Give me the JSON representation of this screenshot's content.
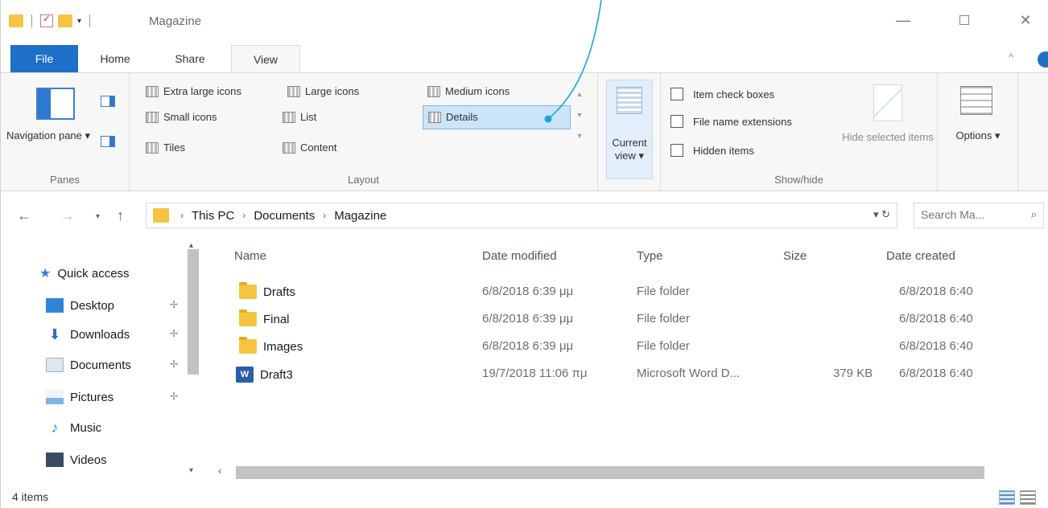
{
  "window": {
    "title": "Magazine",
    "controls": {
      "minimize": "—",
      "close": "✕"
    }
  },
  "tabs": [
    {
      "label": "File"
    },
    {
      "label": "Home"
    },
    {
      "label": "Share"
    },
    {
      "label": "View"
    }
  ],
  "ribbon": {
    "panes": {
      "navigation_pane": "Navigation pane ▾",
      "group_label": "Panes"
    },
    "layout": {
      "items": [
        "Extra large icons",
        "Large icons",
        "Medium icons",
        "Small icons",
        "List",
        "Details",
        "Tiles",
        "Content"
      ],
      "selected": "Details",
      "group_label": "Layout"
    },
    "current_view": {
      "label": "Current view ▾"
    },
    "show_hide": {
      "checkboxes": [
        "Item check boxes",
        "File name extensions",
        "Hidden items"
      ],
      "hide_selected": "Hide selected items",
      "group_label": "Show/hide"
    },
    "options": {
      "label": "Options ▾"
    }
  },
  "address": {
    "crumbs": [
      "This PC",
      "Documents",
      "Magazine"
    ],
    "search_placeholder": "Search Ma..."
  },
  "sidebar": {
    "items": [
      {
        "label": "Quick access",
        "icon": "star-icon",
        "pinned": false
      },
      {
        "label": "Desktop",
        "icon": "desktop-icon",
        "pinned": true
      },
      {
        "label": "Downloads",
        "icon": "download-arrow-icon",
        "pinned": true
      },
      {
        "label": "Documents",
        "icon": "documents-icon",
        "pinned": true
      },
      {
        "label": "Pictures",
        "icon": "pictures-icon",
        "pinned": true
      },
      {
        "label": "Music",
        "icon": "music-icon",
        "pinned": false
      },
      {
        "label": "Videos",
        "icon": "videos-icon",
        "pinned": false
      }
    ]
  },
  "files": {
    "columns": [
      "Name",
      "Date modified",
      "Type",
      "Size",
      "Date created"
    ],
    "rows": [
      {
        "name": "Drafts",
        "modified": "6/8/2018 6:39 μμ",
        "type": "File folder",
        "size": "",
        "created": "6/8/2018 6:40",
        "icon": "folder-icon"
      },
      {
        "name": "Final",
        "modified": "6/8/2018 6:39 μμ",
        "type": "File folder",
        "size": "",
        "created": "6/8/2018 6:40",
        "icon": "folder-icon"
      },
      {
        "name": "Images",
        "modified": "6/8/2018 6:39 μμ",
        "type": "File folder",
        "size": "",
        "created": "6/8/2018 6:40",
        "icon": "folder-icon"
      },
      {
        "name": "Draft3",
        "modified": "19/7/2018 11:06 πμ",
        "type": "Microsoft Word D...",
        "size": "379 KB",
        "created": "6/8/2018 6:40",
        "icon": "word-document-icon"
      }
    ]
  },
  "status": {
    "item_count": "4 items"
  },
  "colors": {
    "file_tab": "#1e6fc8",
    "folder": "#f5c542",
    "selection": "#cce4f7",
    "callout": "#1ea3e0"
  }
}
